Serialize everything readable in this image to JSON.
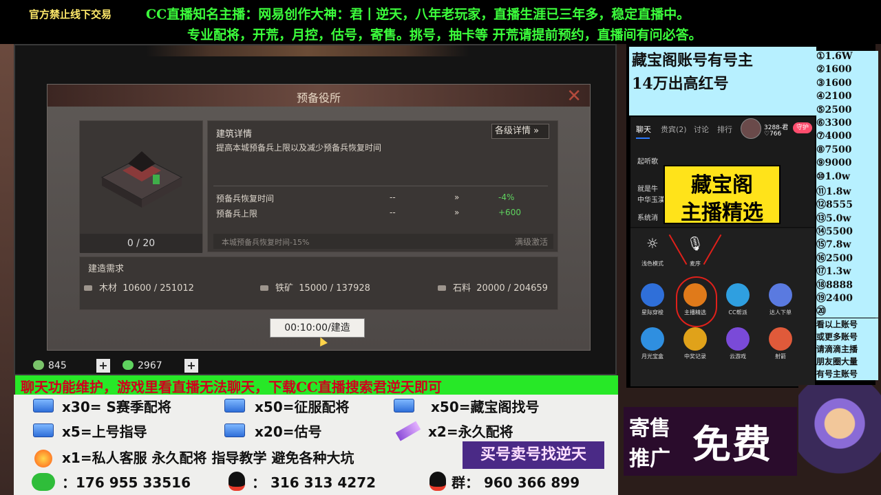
{
  "top": {
    "tag": "官方禁止线下交易",
    "line1": "CC直播知名主播：网易创作大神：君丨逆天，八年老玩家，直播生涯已三年多，稳定直播中。",
    "line2": "专业配将，开荒，月控，估号，寄售。挑号，抽卡等   开荒请提前预约，直播间有问必答。"
  },
  "dialog": {
    "title": "预备役所",
    "close": "✕",
    "building_count": "0 / 20",
    "detail_title": "建筑详情",
    "detail_button": "各级详情 »",
    "description": "提高本城预备兵上限以及减少预备兵恢复时间",
    "stats": [
      {
        "label": "预备兵恢复时间",
        "current": "--",
        "arrow": "»",
        "value": "-4%"
      },
      {
        "label": "预备兵上限",
        "current": "--",
        "arrow": "»",
        "value": "+600"
      }
    ],
    "bonus_text": "本城预备兵恢复时间-15%",
    "full_activate": "满级激活",
    "req_title": "建造需求",
    "requirements": [
      {
        "name": "木材",
        "amount": "10600 / 251012"
      },
      {
        "name": "铁矿",
        "amount": "15000 / 137928"
      },
      {
        "name": "石料",
        "amount": "20000 / 204659"
      }
    ],
    "build_button": "00:10:00/建造"
  },
  "resources": [
    {
      "value": "845",
      "color": "#7ac36a"
    },
    {
      "value": "2967",
      "color": "#5fd35f"
    }
  ],
  "phone_head": {
    "line1": "藏宝阁账号有号主",
    "line2": "14万出高红号"
  },
  "rank_list": [
    "①1.6W",
    "②1600",
    "③1600",
    "④2100",
    "⑤2500",
    "⑥3300",
    "⑦4000",
    "⑧7500",
    "⑨9000",
    "⑩1.0w",
    "⑪1.8w",
    "⑫8555",
    "⑬5.0w",
    "⑭5500",
    "⑮7.8w",
    "⑯2500",
    "⑰1.3w",
    "⑱8888",
    "⑲2400",
    "⑳"
  ],
  "rank_tail": [
    "看以上账号",
    "或更多账号",
    "请滴滴主播",
    "朋友圈大量",
    "有号主账号"
  ],
  "phone": {
    "tabs": [
      "聊天",
      "贵宾(2)",
      "讨论",
      "排行"
    ],
    "anchor_name": "3288-君",
    "anchor_fans": "♡766",
    "guard": "守护",
    "chat": [
      "起听歌",
      "就是牛",
      "中华玉漢",
      "系统消"
    ],
    "promo_a": "藏宝阁",
    "promo_b": "主播精选",
    "tools": [
      {
        "label": "浅色模式",
        "icon": "☼"
      },
      {
        "label": "麦序",
        "icon": "🎙"
      }
    ],
    "menu": [
      {
        "label": "星际穿梭",
        "color": "#2f6fd9"
      },
      {
        "label": "主播精选",
        "color": "#e07a1a"
      },
      {
        "label": "CC帮派",
        "color": "#2f9fe0"
      },
      {
        "label": "达人下单",
        "color": "#5a7ae0"
      },
      {
        "label": "月光宝盒",
        "color": "#2f8fe0"
      },
      {
        "label": "中奖记录",
        "color": "#e0a21a"
      },
      {
        "label": "云游戏",
        "color": "#7a4ad8"
      },
      {
        "label": "射箭",
        "color": "#e05a3a"
      }
    ]
  },
  "notice": "聊天功能维护，游戏里看直播无法聊天，下载CC直播搜索君逆天即可",
  "promo": {
    "r1a": "x30= S赛季配将",
    "r1b": "x50=征服配将",
    "r1c": "x50=藏宝阁找号",
    "r2a": "x5=上号指导",
    "r2b": "x20=估号",
    "r2c": "x2=永久配将",
    "r3": "x1=私人客服 永久配将  指导教学 避免各种大坑",
    "buy_sell": "买号卖号找逆天",
    "r4a": "：176 955 33516",
    "r4b": "：  316 313 4272",
    "r4c": "群：  960 366 899"
  },
  "free": {
    "a": "寄售",
    "b": "推广",
    "c": "免费"
  }
}
